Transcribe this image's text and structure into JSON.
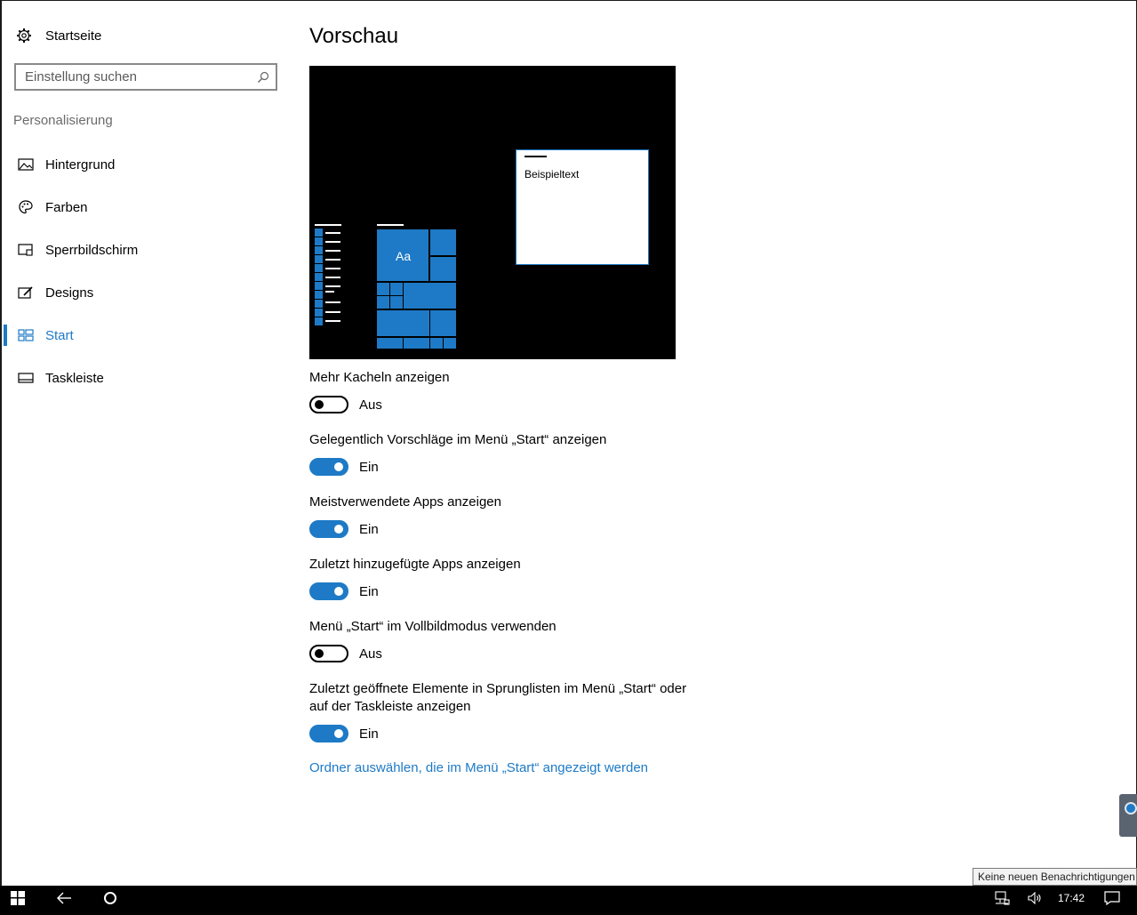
{
  "sidebar": {
    "home_label": "Startseite",
    "search_placeholder": "Einstellung suchen",
    "section_label": "Personalisierung",
    "items": [
      {
        "label": "Hintergrund",
        "icon": "image-icon"
      },
      {
        "label": "Farben",
        "icon": "palette-icon"
      },
      {
        "label": "Sperrbildschirm",
        "icon": "lock-screen-icon"
      },
      {
        "label": "Designs",
        "icon": "designs-icon"
      },
      {
        "label": "Start",
        "icon": "start-tiles-icon",
        "active": true
      },
      {
        "label": "Taskleiste",
        "icon": "taskbar-icon"
      }
    ]
  },
  "main": {
    "title": "Vorschau",
    "preview": {
      "sample_text": "Beispieltext",
      "tile_label": "Aa"
    },
    "settings": [
      {
        "label": "Mehr Kacheln anzeigen",
        "state": "Aus",
        "on": false
      },
      {
        "label": "Gelegentlich Vorschläge im Menü „Start“ anzeigen",
        "state": "Ein",
        "on": true
      },
      {
        "label": "Meistverwendete Apps anzeigen",
        "state": "Ein",
        "on": true
      },
      {
        "label": "Zuletzt hinzugefügte Apps anzeigen",
        "state": "Ein",
        "on": true
      },
      {
        "label": "Menü „Start“ im Vollbildmodus verwenden",
        "state": "Aus",
        "on": false
      },
      {
        "label": "Zuletzt geöffnete Elemente in Sprunglisten im Menü „Start“ oder auf der Taskleiste anzeigen",
        "state": "Ein",
        "on": true
      }
    ],
    "link": "Ordner auswählen, die im Menü „Start“ angezeigt werden"
  },
  "tooltip": "Keine neuen Benachrichtigungen",
  "taskbar": {
    "time": "17:42"
  },
  "colors": {
    "accent": "#1e7ac6",
    "taskbar": "#000000"
  }
}
